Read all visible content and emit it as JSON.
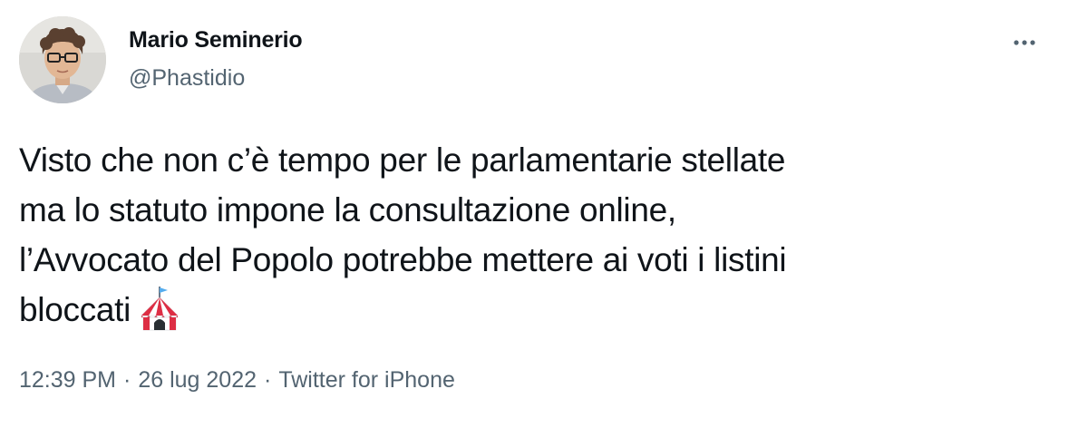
{
  "author": {
    "name": "Mario Seminerio",
    "handle": "@Phastidio"
  },
  "tweet": {
    "lines": [
      "Visto che non c’è tempo per le parlamentarie stellate",
      "ma lo statuto impone la consultazione online,",
      "l’Avvocato del Popolo potrebbe mettere ai voti i listini",
      "bloccati"
    ],
    "emoji": "circus-tent-icon"
  },
  "meta": {
    "time": "12:39 PM",
    "date": "26 lug 2022",
    "source": "Twitter for iPhone",
    "separator": "·"
  },
  "icons": {
    "more": "more-horizontal-icon"
  },
  "colors": {
    "text_primary": "#0f1419",
    "text_secondary": "#536471"
  }
}
